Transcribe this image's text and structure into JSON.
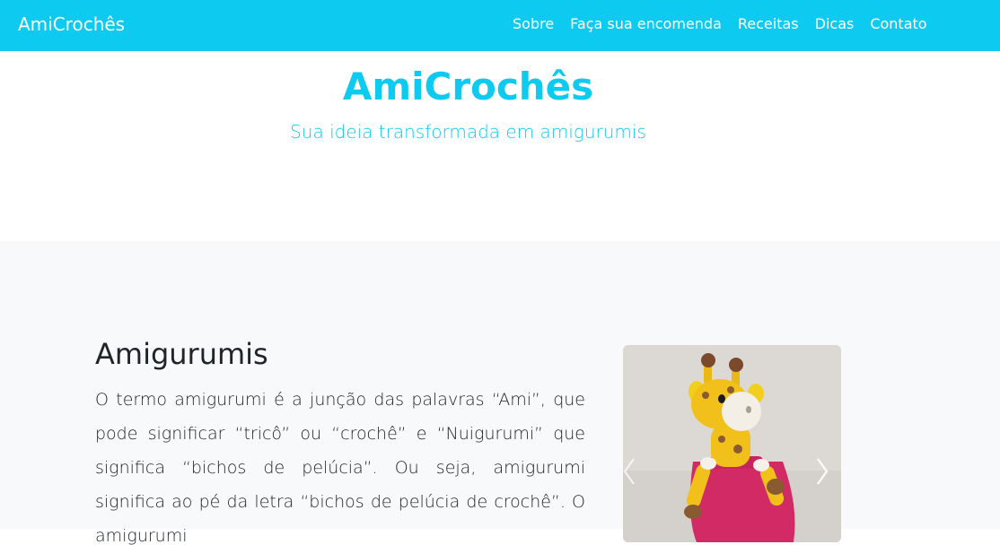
{
  "navbar": {
    "brand": "AmiCrochês",
    "links": [
      {
        "label": "Sobre"
      },
      {
        "label": "Faça sua encomenda"
      },
      {
        "label": "Receitas"
      },
      {
        "label": "Dicas"
      },
      {
        "label": "Contato"
      }
    ]
  },
  "hero": {
    "title": "AmiCrochês",
    "subtitle": "Sua ideia transformada em amigurumis"
  },
  "about": {
    "title": "Amigurumis",
    "text": "O termo amigurumi é a junção das palavras “Ami”, que pode significar “tricô” ou “crochê” e “Nuigurumi” que significa “bichos de pelúcia”. Ou seja, amigurumi significa ao pé da letra “bichos de pelúcia de crochê”. O amigurumi"
  },
  "carousel": {
    "image_subject": "giraffe-amigurumi",
    "prev_icon": "chevron-left-icon",
    "next_icon": "chevron-right-icon"
  },
  "colors": {
    "primary": "#0dcaf0",
    "light_bg": "#f8f9fa",
    "text": "#212529"
  }
}
